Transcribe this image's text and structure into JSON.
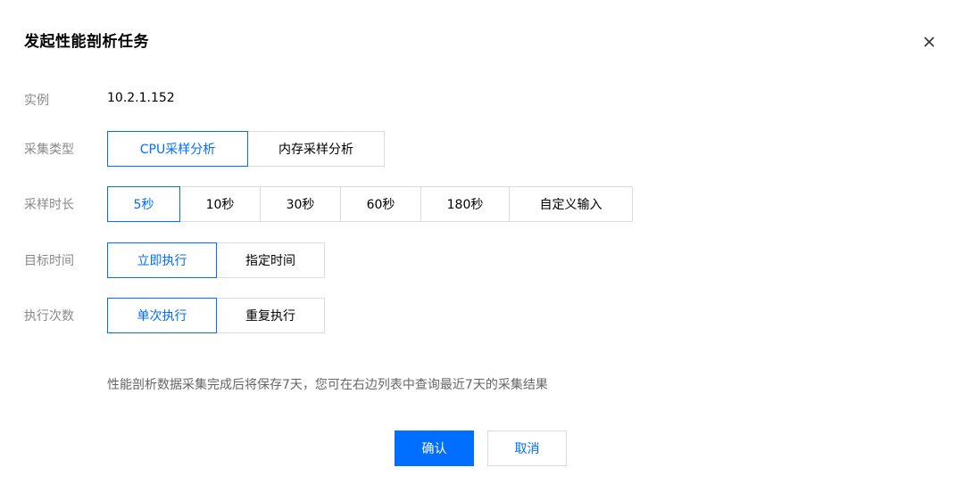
{
  "dialog": {
    "title": "发起性能剖析任务",
    "close_icon": "close-icon"
  },
  "instance": {
    "label": "实例",
    "value": "10.2.1.152"
  },
  "collect_type": {
    "label": "采集类型",
    "options": [
      "CPU采样分析",
      "内存采样分析"
    ],
    "selected": "CPU采样分析"
  },
  "duration": {
    "label": "采样时长",
    "options": [
      "5秒",
      "10秒",
      "30秒",
      "60秒",
      "180秒",
      "自定义输入"
    ],
    "selected": "5秒"
  },
  "target_time": {
    "label": "目标时间",
    "options": [
      "立即执行",
      "指定时间"
    ],
    "selected": "立即执行"
  },
  "exec_count": {
    "label": "执行次数",
    "options": [
      "单次执行",
      "重复执行"
    ],
    "selected": "单次执行"
  },
  "hint": "性能剖析数据采集完成后将保存7天，您可在右边列表中查询最近7天的采集结果",
  "footer": {
    "confirm_label": "确认",
    "cancel_label": "取消"
  },
  "colors": {
    "accent": "#006eff",
    "border": "#dcdcdc",
    "label": "#888888"
  }
}
